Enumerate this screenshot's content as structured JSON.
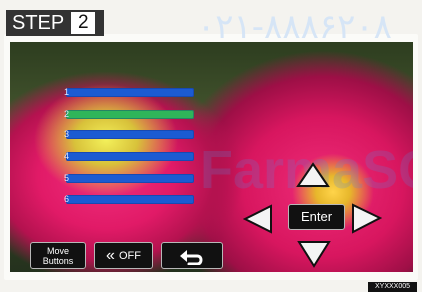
{
  "step": {
    "label": "STEP",
    "number": "2"
  },
  "watermark": {
    "phone": "۰۲۱-۸۸۸۶۲۰۸",
    "brand": "FarmaSC"
  },
  "bars": [
    {
      "index": "1",
      "color": "#1b5bd2",
      "highlighted": false
    },
    {
      "index": "2",
      "color": "#2fb55a",
      "highlighted": true
    },
    {
      "index": "3",
      "color": "#1b5bd2",
      "highlighted": false
    },
    {
      "index": "4",
      "color": "#1b5bd2",
      "highlighted": false
    },
    {
      "index": "5",
      "color": "#1b5bd2",
      "highlighted": false
    },
    {
      "index": "6",
      "color": "#1b5bd2",
      "highlighted": false
    }
  ],
  "buttons": {
    "move": "Move\nButtons",
    "off": "OFF",
    "enter": "Enter"
  },
  "footer_code": "XYXXX005"
}
